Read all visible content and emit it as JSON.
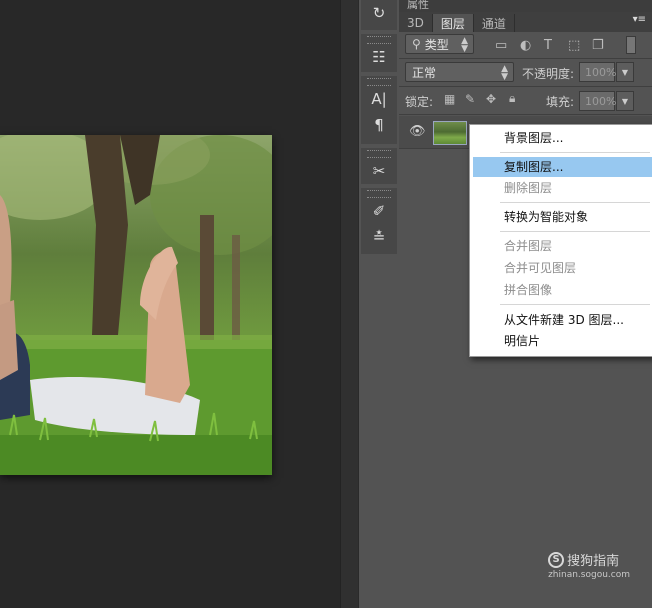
{
  "panel": {
    "top_label": "属性",
    "tabs": [
      "3D",
      "图层",
      "通道"
    ],
    "filter": {
      "label": "类型"
    },
    "blend_mode": "正常",
    "opacity_label": "不透明度:",
    "opacity_value": "100%",
    "lock_label": "锁定:",
    "fill_label": "填充:",
    "fill_value": "100%"
  },
  "context_menu": {
    "items": [
      {
        "label": "背景图层...",
        "enabled": true,
        "highlighted": false
      },
      {
        "label": "复制图层...",
        "enabled": true,
        "highlighted": true
      },
      {
        "label": "删除图层",
        "enabled": false,
        "highlighted": false
      },
      {
        "label": "转换为智能对象",
        "enabled": true,
        "highlighted": false
      },
      {
        "label": "合并图层",
        "enabled": false,
        "highlighted": false
      },
      {
        "label": "合并可见图层",
        "enabled": false,
        "highlighted": false
      },
      {
        "label": "拼合图像",
        "enabled": false,
        "highlighted": false
      },
      {
        "label": "从文件新建 3D 图层...",
        "enabled": true,
        "highlighted": false
      },
      {
        "label": "明信片",
        "enabled": true,
        "highlighted": false
      }
    ]
  },
  "watermark": {
    "brand": "搜狗指南",
    "url": "zhinan.sogou.com"
  },
  "colors": {
    "menu_highlight": "#97c8f0",
    "panel_bg": "#535353",
    "canvas_bg": "#282828"
  }
}
